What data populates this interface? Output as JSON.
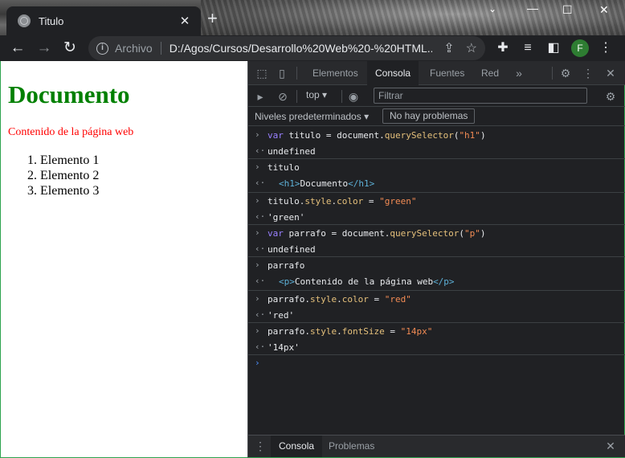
{
  "browser": {
    "tab_title": "Titulo",
    "tab_close": "✕",
    "new_tab": "+",
    "url_scheme": "Archivo",
    "url": "D:/Agos/Cursos/Desarrollo%20Web%20-%20HTML...",
    "profile_initial": "F"
  },
  "page": {
    "heading": "Documento",
    "paragraph": "Contenido de la página web",
    "list": [
      {
        "num": "1.",
        "text": "Elemento 1"
      },
      {
        "num": "2.",
        "text": "Elemento 2"
      },
      {
        "num": "3.",
        "text": "Elemento 3"
      }
    ],
    "heading_color": "#008000",
    "paragraph_color": "#ff0000"
  },
  "devtools": {
    "tabs": [
      "Elementos",
      "Consola",
      "Fuentes",
      "Red"
    ],
    "active_tab": "Consola",
    "context": "top",
    "filter_placeholder": "Filtrar",
    "levels": "Niveles predeterminados",
    "issues": "No hay problemas",
    "console": {
      "c1": "var titulo = document.querySelector(\"h1\")",
      "r1": "undefined",
      "c2": "titulo",
      "r2": "<h1>Documento</h1>",
      "c3": "titulo.style.color = \"green\"",
      "r3": "'green'",
      "c4": "var parrafo = document.querySelector(\"p\")",
      "r4": "undefined",
      "c5": "parrafo",
      "r5": "<p>Contenido de la página web</p>",
      "c6": "parrafo.style.color = \"red\"",
      "r6": "'red'",
      "c7": "parrafo.style.fontSize = \"14px\"",
      "r7": "'14px'"
    },
    "drawer_tabs": [
      "Consola",
      "Problemas"
    ]
  }
}
